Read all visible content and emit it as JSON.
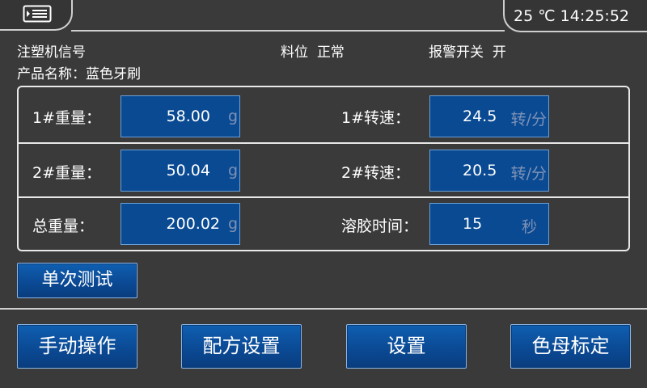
{
  "status": {
    "temperature": "25 ℃",
    "time": "14:25:52"
  },
  "info": {
    "signal_label": "注塑机信号",
    "material_label": "料位",
    "material_value": "正常",
    "alarm_label": "报警开关",
    "alarm_value": "开",
    "product_label": "产品名称：",
    "product_value": "蓝色牙刷"
  },
  "rows": [
    {
      "left_label": "1#重量：",
      "left_value": "58.00",
      "left_unit": "g",
      "right_label": "1#转速：",
      "right_value": "24.5",
      "right_unit": "转/分"
    },
    {
      "left_label": "2#重量：",
      "left_value": "50.04",
      "left_unit": "g",
      "right_label": "2#转速：",
      "right_value": "20.5",
      "right_unit": "转/分"
    },
    {
      "left_label": "总重量：",
      "left_value": "200.02",
      "left_unit": "g",
      "right_label": "溶胶时间：",
      "right_value": "15",
      "right_unit": "秒"
    }
  ],
  "buttons": {
    "single_test": "单次测试",
    "manual": "手动操作",
    "recipe": "配方设置",
    "settings": "设置",
    "color_calibration": "色母标定"
  },
  "icons": {
    "menu": "menu-list-icon"
  },
  "colors": {
    "background": "#3a3a3a",
    "field": "#0a4a93",
    "button": "#0b4a95"
  }
}
